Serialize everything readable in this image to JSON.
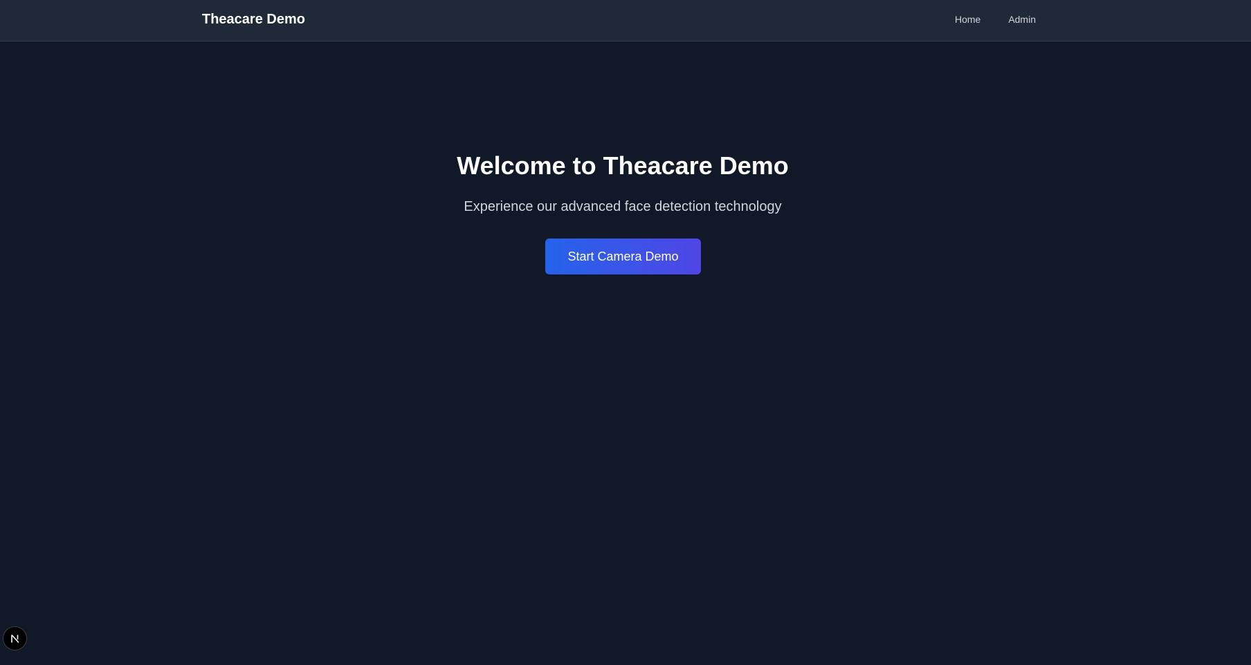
{
  "header": {
    "brand": "Theacare Demo",
    "nav": [
      {
        "label": "Home"
      },
      {
        "label": "Admin"
      }
    ]
  },
  "hero": {
    "title": "Welcome to Theacare Demo",
    "subtitle": "Experience our advanced face detection technology",
    "cta_label": "Start Camera Demo"
  },
  "dev_badge": {
    "icon": "nextjs-logo-icon",
    "letter": "N"
  },
  "colors": {
    "background": "#111827",
    "navbar": "#1f2937",
    "cta_gradient_start": "#2563eb",
    "cta_gradient_end": "#4f46e5"
  }
}
